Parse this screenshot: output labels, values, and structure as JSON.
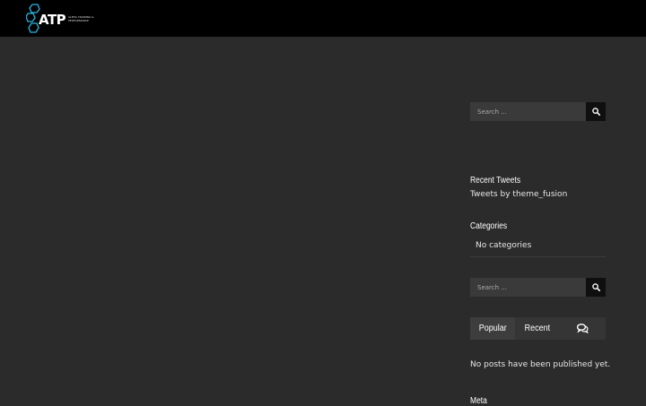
{
  "header": {
    "logo_text": "ATP",
    "logo_tagline_1": "ALPHA TRAINING &",
    "logo_tagline_2": "PERFORMANCE",
    "accent_color": "#27b6e0"
  },
  "sidebar": {
    "search_top": {
      "placeholder": "Search ...",
      "button_icon": "search-icon"
    },
    "recent_tweets": {
      "title": "Recent Tweets",
      "text": "Tweets by theme_fusion"
    },
    "categories": {
      "title": "Categories",
      "items": [
        "No categories"
      ]
    },
    "search_bottom": {
      "placeholder": "Search ...",
      "button_icon": "search-icon"
    },
    "tabs": {
      "items": [
        {
          "label": "Popular",
          "active": true
        },
        {
          "label": "Recent",
          "active": false
        },
        {
          "label": "",
          "icon": "comments-icon",
          "active": false
        }
      ],
      "empty_message": "No posts have been published yet."
    },
    "meta": {
      "title": "Meta"
    }
  }
}
